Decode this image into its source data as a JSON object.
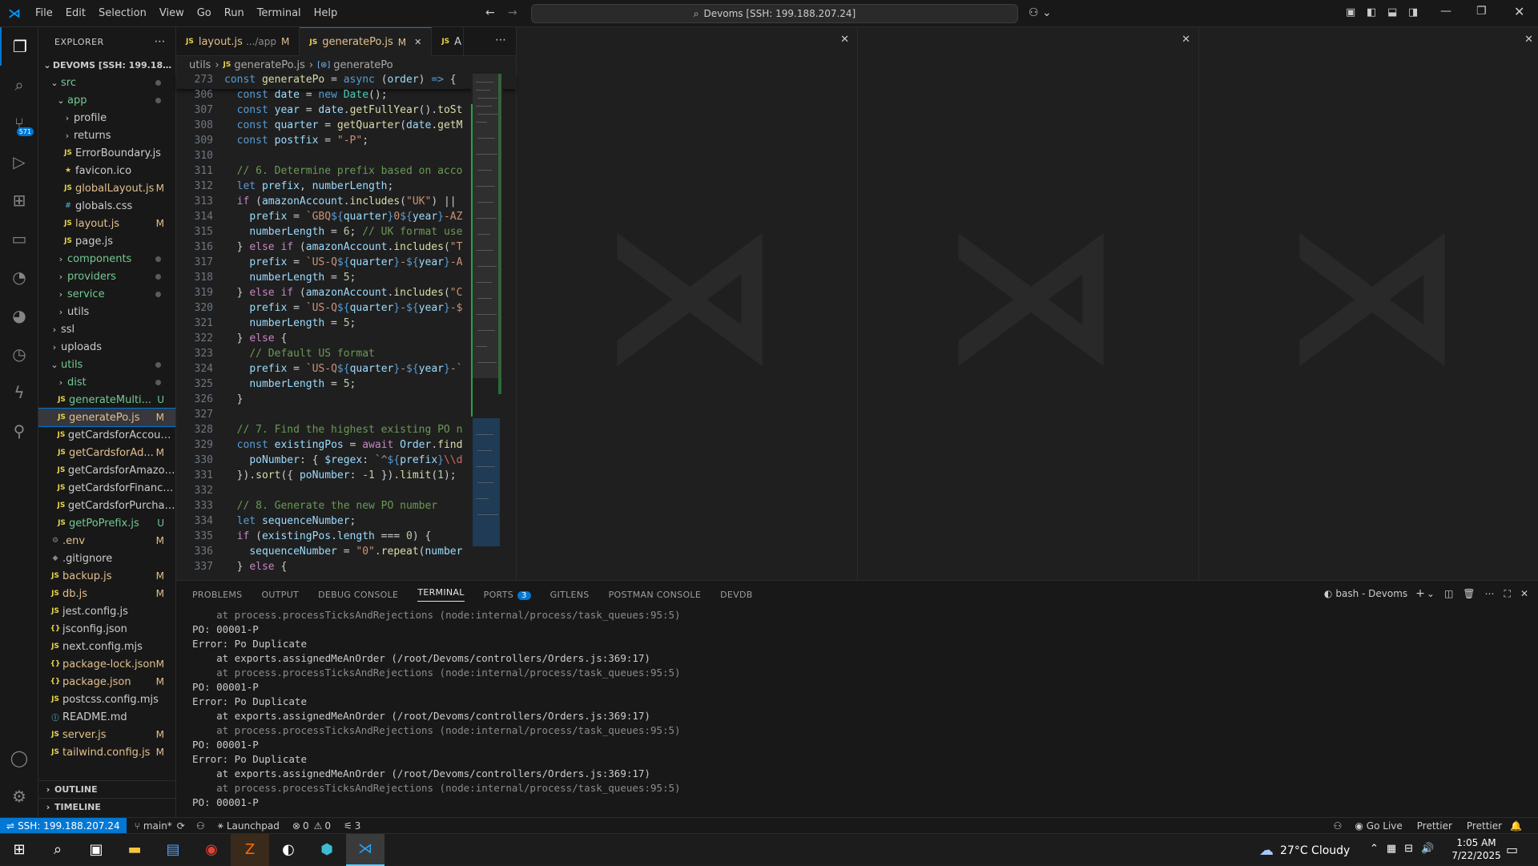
{
  "menu": [
    "File",
    "Edit",
    "Selection",
    "View",
    "Go",
    "Run",
    "Terminal",
    "Help"
  ],
  "command_center": "Devoms [SSH: 199.188.207.24]",
  "explorer": {
    "title": "EXPLORER",
    "root": "DEVOMS [SSH: 199.188.20...",
    "items": [
      {
        "indent": 1,
        "type": "folder",
        "open": true,
        "label": "src",
        "status": "dot"
      },
      {
        "indent": 2,
        "type": "folder",
        "open": true,
        "label": "app",
        "status": "dot"
      },
      {
        "indent": 3,
        "type": "folder",
        "open": false,
        "label": "profile",
        "status": ""
      },
      {
        "indent": 3,
        "type": "folder",
        "open": false,
        "label": "returns",
        "status": ""
      },
      {
        "indent": 3,
        "type": "js",
        "label": "ErrorBoundary.js",
        "status": ""
      },
      {
        "indent": 3,
        "type": "star",
        "label": "favicon.ico",
        "status": ""
      },
      {
        "indent": 3,
        "type": "js",
        "label": "globalLayout.js",
        "status": "M"
      },
      {
        "indent": 3,
        "type": "css",
        "label": "globals.css",
        "status": ""
      },
      {
        "indent": 3,
        "type": "js",
        "label": "layout.js",
        "status": "M"
      },
      {
        "indent": 3,
        "type": "js",
        "label": "page.js",
        "status": ""
      },
      {
        "indent": 2,
        "type": "folder",
        "open": false,
        "label": "components",
        "status": "dot"
      },
      {
        "indent": 2,
        "type": "folder",
        "open": false,
        "label": "providers",
        "status": "dot"
      },
      {
        "indent": 2,
        "type": "folder",
        "open": false,
        "label": "service",
        "status": "dot"
      },
      {
        "indent": 2,
        "type": "folder",
        "open": false,
        "label": "utils",
        "status": ""
      },
      {
        "indent": 1,
        "type": "folder",
        "open": false,
        "label": "ssl",
        "status": ""
      },
      {
        "indent": 1,
        "type": "folder",
        "open": false,
        "label": "uploads",
        "status": ""
      },
      {
        "indent": 1,
        "type": "folder",
        "open": true,
        "label": "utils",
        "status": "dot"
      },
      {
        "indent": 2,
        "type": "folder",
        "open": false,
        "label": "dist",
        "status": "dot"
      },
      {
        "indent": 2,
        "type": "js",
        "label": "generateMulti...",
        "status": "U"
      },
      {
        "indent": 2,
        "type": "js",
        "label": "generatePo.js",
        "status": "M",
        "selected": true
      },
      {
        "indent": 2,
        "type": "js",
        "label": "getCardsforAccount.js",
        "status": ""
      },
      {
        "indent": 2,
        "type": "js",
        "label": "getCardsforAd...",
        "status": "M"
      },
      {
        "indent": 2,
        "type": "js",
        "label": "getCardsforAmazon.js",
        "status": ""
      },
      {
        "indent": 2,
        "type": "js",
        "label": "getCardsforFinance.js",
        "status": ""
      },
      {
        "indent": 2,
        "type": "js",
        "label": "getCardsforPurchasi...",
        "status": ""
      },
      {
        "indent": 2,
        "type": "js",
        "label": "getPoPrefix.js",
        "status": "U"
      },
      {
        "indent": 1,
        "type": "gear",
        "label": ".env",
        "status": "M"
      },
      {
        "indent": 1,
        "type": "git",
        "label": ".gitignore",
        "status": ""
      },
      {
        "indent": 1,
        "type": "js",
        "label": "backup.js",
        "status": "M"
      },
      {
        "indent": 1,
        "type": "js",
        "label": "db.js",
        "status": "M"
      },
      {
        "indent": 1,
        "type": "js",
        "label": "jest.config.js",
        "status": ""
      },
      {
        "indent": 1,
        "type": "json",
        "label": "jsconfig.json",
        "status": ""
      },
      {
        "indent": 1,
        "type": "js",
        "label": "next.config.mjs",
        "status": ""
      },
      {
        "indent": 1,
        "type": "json",
        "label": "package-lock.json",
        "status": "M"
      },
      {
        "indent": 1,
        "type": "json",
        "label": "package.json",
        "status": "M"
      },
      {
        "indent": 1,
        "type": "js",
        "label": "postcss.config.mjs",
        "status": ""
      },
      {
        "indent": 1,
        "type": "info",
        "label": "README.md",
        "status": ""
      },
      {
        "indent": 1,
        "type": "js",
        "label": "server.js",
        "status": "M"
      },
      {
        "indent": 1,
        "type": "js",
        "label": "tailwind.config.js",
        "status": "M"
      }
    ],
    "outline": "OUTLINE",
    "timeline": "TIMELINE"
  },
  "tabs": [
    {
      "icon": "JS",
      "label": "layout.js",
      "desc": ".../app",
      "status": "M",
      "active": false
    },
    {
      "icon": "JS",
      "label": "generatePo.js",
      "desc": "",
      "status": "M",
      "active": true
    },
    {
      "icon": "JS",
      "label": "A",
      "desc": "",
      "status": "",
      "active": false
    }
  ],
  "breadcrumb": [
    "utils",
    "generatePo.js",
    "generatePo"
  ],
  "code": [
    {
      "n": "273",
      "h": "<span class='kw'>const</span> <span class='fn'>generatePo</span> = <span class='kw'>async</span> (<span class='vr'>order</span>) <span class='kw'>=></span> {"
    },
    {
      "n": "306",
      "h": "  <span class='kw'>const</span> <span class='vr'>date</span> = <span class='kw'>new</span> <span class='cls'>Date</span>();"
    },
    {
      "n": "307",
      "h": "  <span class='kw'>const</span> <span class='vr'>year</span> = <span class='vr'>date</span>.<span class='fn'>getFullYear</span>().<span class='fn'>toSt</span>"
    },
    {
      "n": "308",
      "h": "  <span class='kw'>const</span> <span class='vr'>quarter</span> = <span class='fn'>getQuarter</span>(<span class='vr'>date</span>.<span class='fn'>getM</span>"
    },
    {
      "n": "309",
      "h": "  <span class='kw'>const</span> <span class='vr'>postfix</span> = <span class='str'>\"-P\"</span>;"
    },
    {
      "n": "310",
      "h": ""
    },
    {
      "n": "311",
      "h": "  <span class='cm'>// 6. Determine prefix based on acco</span>"
    },
    {
      "n": "312",
      "h": "  <span class='kw'>let</span> <span class='vr'>prefix</span>, <span class='vr'>numberLength</span>;"
    },
    {
      "n": "313",
      "h": "  <span class='kw2'>if</span> (<span class='vr'>amazonAccount</span>.<span class='fn'>includes</span>(<span class='str'>\"UK\"</span>) ||"
    },
    {
      "n": "314",
      "h": "    <span class='vr'>prefix</span> = <span class='str'>`GBQ</span><span class='tp'>${</span><span class='vr'>quarter</span><span class='tp'>}</span><span class='str'>0</span><span class='tp'>${</span><span class='vr'>year</span><span class='tp'>}</span><span class='str'>-AZ</span>"
    },
    {
      "n": "315",
      "h": "    <span class='vr'>numberLength</span> = <span class='num'>6</span>; <span class='cm'>// UK format use</span>"
    },
    {
      "n": "316",
      "h": "  } <span class='kw2'>else if</span> (<span class='vr'>amazonAccount</span>.<span class='fn'>includes</span>(<span class='str'>\"T</span>"
    },
    {
      "n": "317",
      "h": "    <span class='vr'>prefix</span> = <span class='str'>`US-Q</span><span class='tp'>${</span><span class='vr'>quarter</span><span class='tp'>}</span><span class='str'>-</span><span class='tp'>${</span><span class='vr'>year</span><span class='tp'>}</span><span class='str'>-A</span>"
    },
    {
      "n": "318",
      "h": "    <span class='vr'>numberLength</span> = <span class='num'>5</span>;"
    },
    {
      "n": "319",
      "h": "  } <span class='kw2'>else if</span> (<span class='vr'>amazonAccount</span>.<span class='fn'>includes</span>(<span class='str'>\"C</span>"
    },
    {
      "n": "320",
      "h": "    <span class='vr'>prefix</span> = <span class='str'>`US-Q</span><span class='tp'>${</span><span class='vr'>quarter</span><span class='tp'>}</span><span class='str'>-</span><span class='tp'>${</span><span class='vr'>year</span><span class='tp'>}</span><span class='str'>-$</span>"
    },
    {
      "n": "321",
      "h": "    <span class='vr'>numberLength</span> = <span class='num'>5</span>;"
    },
    {
      "n": "322",
      "h": "  } <span class='kw2'>else</span> {"
    },
    {
      "n": "323",
      "h": "    <span class='cm'>// Default US format</span>"
    },
    {
      "n": "324",
      "h": "    <span class='vr'>prefix</span> = <span class='str'>`US-Q</span><span class='tp'>${</span><span class='vr'>quarter</span><span class='tp'>}</span><span class='str'>-</span><span class='tp'>${</span><span class='vr'>year</span><span class='tp'>}</span><span class='str'>-`</span>"
    },
    {
      "n": "325",
      "h": "    <span class='vr'>numberLength</span> = <span class='num'>5</span>;"
    },
    {
      "n": "326",
      "h": "  }"
    },
    {
      "n": "327",
      "h": ""
    },
    {
      "n": "328",
      "h": "  <span class='cm'>// 7. Find the highest existing PO n</span>"
    },
    {
      "n": "329",
      "h": "  <span class='kw'>const</span> <span class='vr'>existingPos</span> = <span class='kw2'>await</span> <span class='vr'>Order</span>.<span class='fn'>find</span>"
    },
    {
      "n": "330",
      "h": "    <span class='vr'>poNumber</span>: { <span class='vr'>$regex</span>: <span class='str'>`^</span><span class='tp'>${</span><span class='vr'>prefix</span><span class='tp'>}</span><span class='rx'>\\\\d</span>"
    },
    {
      "n": "331",
      "h": "  }).<span class='fn'>sort</span>({ <span class='vr'>poNumber</span>: <span class='num'>-1</span> }).<span class='fn'>limit</span>(<span class='num'>1</span>);"
    },
    {
      "n": "332",
      "h": ""
    },
    {
      "n": "333",
      "h": "  <span class='cm'>// 8. Generate the new PO number</span>"
    },
    {
      "n": "334",
      "h": "  <span class='kw'>let</span> <span class='vr'>sequenceNumber</span>;"
    },
    {
      "n": "335",
      "h": "  <span class='kw2'>if</span> (<span class='vr'>existingPos</span>.<span class='vr'>length</span> === <span class='num'>0</span>) {"
    },
    {
      "n": "336",
      "h": "    <span class='vr'>sequenceNumber</span> = <span class='str'>\"0\"</span>.<span class='fn'>repeat</span>(<span class='vr'>number</span>"
    },
    {
      "n": "337",
      "h": "  } <span class='kw2'>else</span> {"
    }
  ],
  "panel": {
    "tabs": [
      "PROBLEMS",
      "OUTPUT",
      "DEBUG CONSOLE",
      "TERMINAL",
      "PORTS",
      "GITLENS",
      "POSTMAN CONSOLE",
      "DEVDB"
    ],
    "active_tab": "TERMINAL",
    "ports_badge": "3",
    "terminal_name": "bash - Devoms",
    "lines": [
      {
        "t": "    at process.processTicksAndRejections (node:internal/process/task_queues:95:5)",
        "g": true
      },
      {
        "t": "PO: 00001-P",
        "g": false
      },
      {
        "t": "Error: Po Duplicate",
        "g": false
      },
      {
        "t": "    at exports.assignedMeAnOrder (/root/Devoms/controllers/Orders.js:369:17)",
        "g": false
      },
      {
        "t": "    at process.processTicksAndRejections (node:internal/process/task_queues:95:5)",
        "g": true
      },
      {
        "t": "PO: 00001-P",
        "g": false
      },
      {
        "t": "Error: Po Duplicate",
        "g": false
      },
      {
        "t": "    at exports.assignedMeAnOrder (/root/Devoms/controllers/Orders.js:369:17)",
        "g": false
      },
      {
        "t": "    at process.processTicksAndRejections (node:internal/process/task_queues:95:5)",
        "g": true
      },
      {
        "t": "PO: 00001-P",
        "g": false
      },
      {
        "t": "Error: Po Duplicate",
        "g": false
      },
      {
        "t": "    at exports.assignedMeAnOrder (/root/Devoms/controllers/Orders.js:369:17)",
        "g": false
      },
      {
        "t": "    at process.processTicksAndRejections (node:internal/process/task_queues:95:5)",
        "g": true
      },
      {
        "t": "PO: 00001-P",
        "g": false
      }
    ]
  },
  "status": {
    "remote": "SSH: 199.188.207.24",
    "branch": "main*",
    "launchpad": "Launchpad",
    "errors": "0",
    "warnings": "0",
    "ports": "3",
    "golive": "Go Live",
    "prettier1": "Prettier",
    "prettier2": "Prettier"
  },
  "taskbar": {
    "weather": "27°C  Cloudy",
    "time": "1:05 AM",
    "date": "7/22/2025"
  },
  "source_control_badge": "571"
}
